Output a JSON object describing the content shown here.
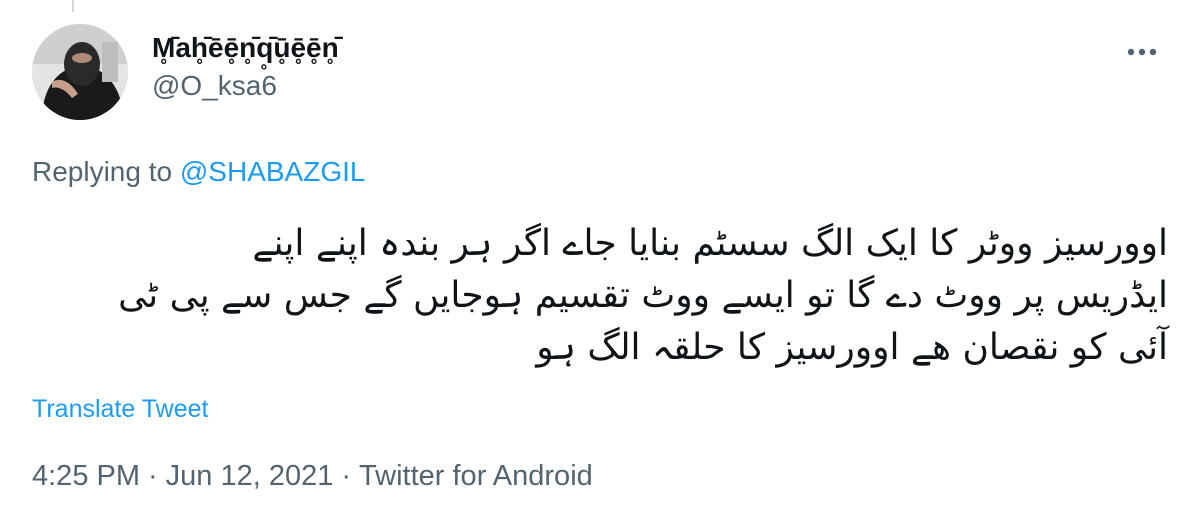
{
  "tweet": {
    "display_name": "M̥̄ah̥̄ēē̥n̥̄q̥̄ū̥ē̥ē̥n̥̄",
    "handle": "@O_ksa6",
    "replying_prefix": "Replying to",
    "replying_to": "@SHABAZGIL",
    "body": "اوورسیز ووٹر کا ایک الگ سسٹم بنایا جاے اگر ہر بندہ اپنے اپنے\nایڈریس پر ووٹ دے گا تو ایسے ووٹ تقسیم ہوجایں گے جس سے پی ٹی\nآئی کو نقصان ھے اوورسیز کا حلقہ الگ ہو",
    "translate_label": "Translate Tweet",
    "time": "4:25 PM",
    "date": "Jun 12, 2021",
    "separator": "·",
    "source": "Twitter for Android"
  },
  "icons": {
    "more": "more-horizontal-icon",
    "avatar": "profile-avatar"
  },
  "colors": {
    "link": "#1d9bf0",
    "secondary_text": "#536471",
    "primary_text": "#0f1419"
  }
}
